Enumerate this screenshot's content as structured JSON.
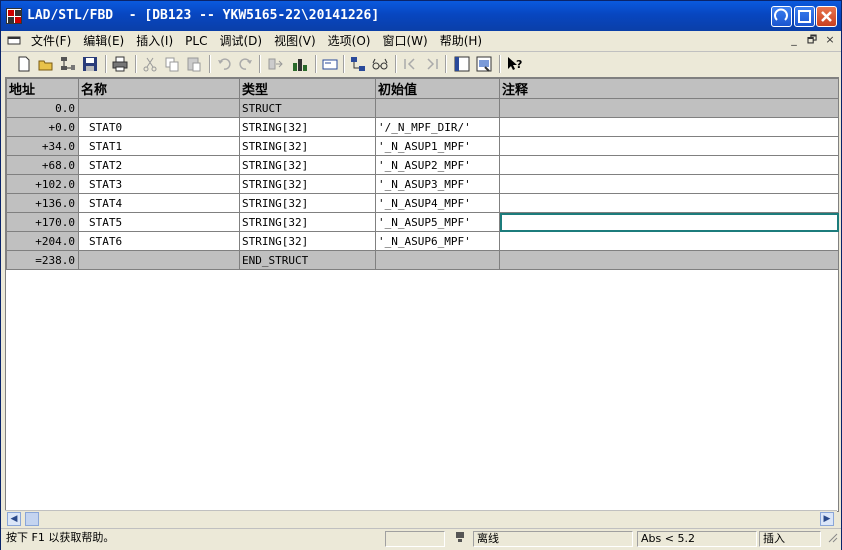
{
  "window": {
    "title": "LAD/STL/FBD  - [DB123 -- YKW5165-22\\20141226]"
  },
  "menu": {
    "items": [
      "文件(F)",
      "编辑(E)",
      "插入(I)",
      "PLC",
      "调试(D)",
      "视图(V)",
      "选项(O)",
      "窗口(W)",
      "帮助(H)"
    ],
    "mdi_controls": [
      "_",
      "🗗",
      "×"
    ]
  },
  "table": {
    "headers": [
      "地址",
      "名称",
      "类型",
      "初始值",
      "注释"
    ],
    "rows": [
      {
        "address": "0.0",
        "name": "",
        "type": "STRUCT",
        "initial": "",
        "comment": ""
      },
      {
        "address": "+0.0",
        "name": "STAT0",
        "type": "STRING[32]",
        "initial": "'/_N_MPF_DIR/'",
        "comment": ""
      },
      {
        "address": "+34.0",
        "name": "STAT1",
        "type": "STRING[32]",
        "initial": "'_N_ASUP1_MPF'",
        "comment": ""
      },
      {
        "address": "+68.0",
        "name": "STAT2",
        "type": "STRING[32]",
        "initial": "'_N_ASUP2_MPF'",
        "comment": ""
      },
      {
        "address": "+102.0",
        "name": "STAT3",
        "type": "STRING[32]",
        "initial": "'_N_ASUP3_MPF'",
        "comment": ""
      },
      {
        "address": "+136.0",
        "name": "STAT4",
        "type": "STRING[32]",
        "initial": "'_N_ASUP4_MPF'",
        "comment": ""
      },
      {
        "address": "+170.0",
        "name": "STAT5",
        "type": "STRING[32]",
        "initial": "'_N_ASUP5_MPF'",
        "comment": ""
      },
      {
        "address": "+204.0",
        "name": "STAT6",
        "type": "STRING[32]",
        "initial": "'_N_ASUP6_MPF'",
        "comment": ""
      },
      {
        "address": "=238.0",
        "name": "",
        "type": "END_STRUCT",
        "initial": "",
        "comment": ""
      }
    ]
  },
  "status": {
    "help": "按下 F1 以获取帮助。",
    "mode": "离线",
    "abs": "Abs < 5.2",
    "insert": "插入"
  },
  "colors": {
    "title_bar": "#0a5ade",
    "selection_outline": "#1c7c7c",
    "header_gray": "#c0c0c0"
  }
}
